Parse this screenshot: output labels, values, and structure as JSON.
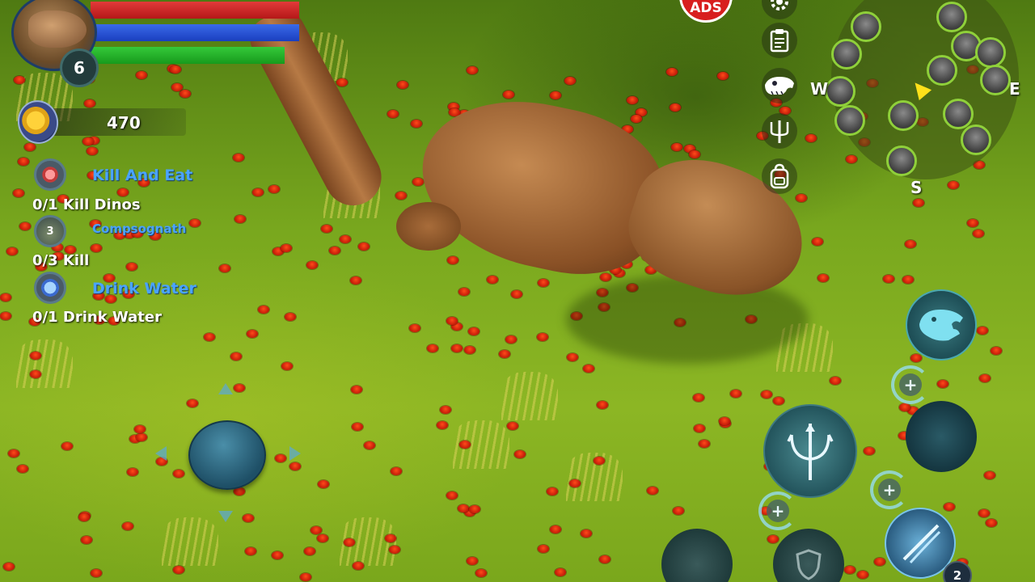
{
  "player": {
    "level": "6",
    "health_fraction": 1.0,
    "stamina_fraction": 1.0,
    "hunger_fraction": 0.93
  },
  "currency": {
    "coins": "470",
    "icon": "coin-icon"
  },
  "quests": [
    {
      "title": "Kill And Eat",
      "progress": "0/1 Kill Dinos",
      "icon": "meat-icon",
      "badge": ""
    },
    {
      "title": "Compsognath",
      "progress": "0/3 Kill",
      "icon": "compsognathus-icon",
      "badge": "3"
    },
    {
      "title": "Drink Water",
      "progress": "0/1 Drink Water",
      "icon": "water-drop-icon",
      "badge": ""
    }
  ],
  "top_bar": {
    "ads_label": "ADS"
  },
  "side_menu": [
    {
      "name": "settings",
      "icon": "gear-icon"
    },
    {
      "name": "quests",
      "icon": "clipboard-icon"
    },
    {
      "name": "dino-select",
      "icon": "dino-skull-icon"
    },
    {
      "name": "skills",
      "icon": "trident-icon"
    },
    {
      "name": "inventory",
      "icon": "backpack-icon"
    }
  ],
  "minimap": {
    "compass": {
      "west": "W",
      "east": "E",
      "south": "S"
    },
    "player_marker_color": "#ffe11a",
    "enemy_ring_color": "#8fd03a"
  },
  "controls": {
    "claw_count": "2",
    "add_symbol": "+"
  },
  "colors": {
    "health": "#e23a3a",
    "stamina": "#3a6ae8",
    "hunger": "#35c93a",
    "quest_title": "#4aa3ff"
  }
}
